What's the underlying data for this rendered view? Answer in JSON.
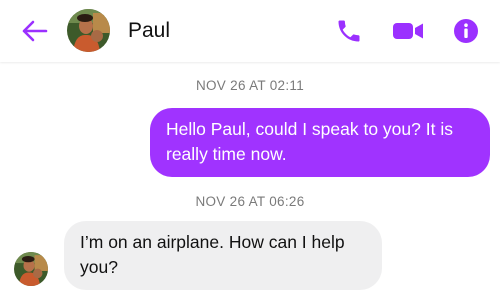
{
  "header": {
    "contact_name": "Paul",
    "accent_color": "#9b30ff",
    "icons": [
      "back-arrow-icon",
      "phone-icon",
      "video-camera-icon",
      "info-icon"
    ]
  },
  "conversation": {
    "timestamps": [
      "NOV 26 AT 02:11",
      "NOV 26 AT 06:26"
    ],
    "messages": [
      {
        "direction": "outgoing",
        "text": "Hello Paul, could I speak to you? It is really time now.",
        "bubble_color": "#a033ff"
      },
      {
        "direction": "incoming",
        "text": "I’m on an airplane. How can I help you?",
        "bubble_color": "#efeff0"
      }
    ]
  }
}
